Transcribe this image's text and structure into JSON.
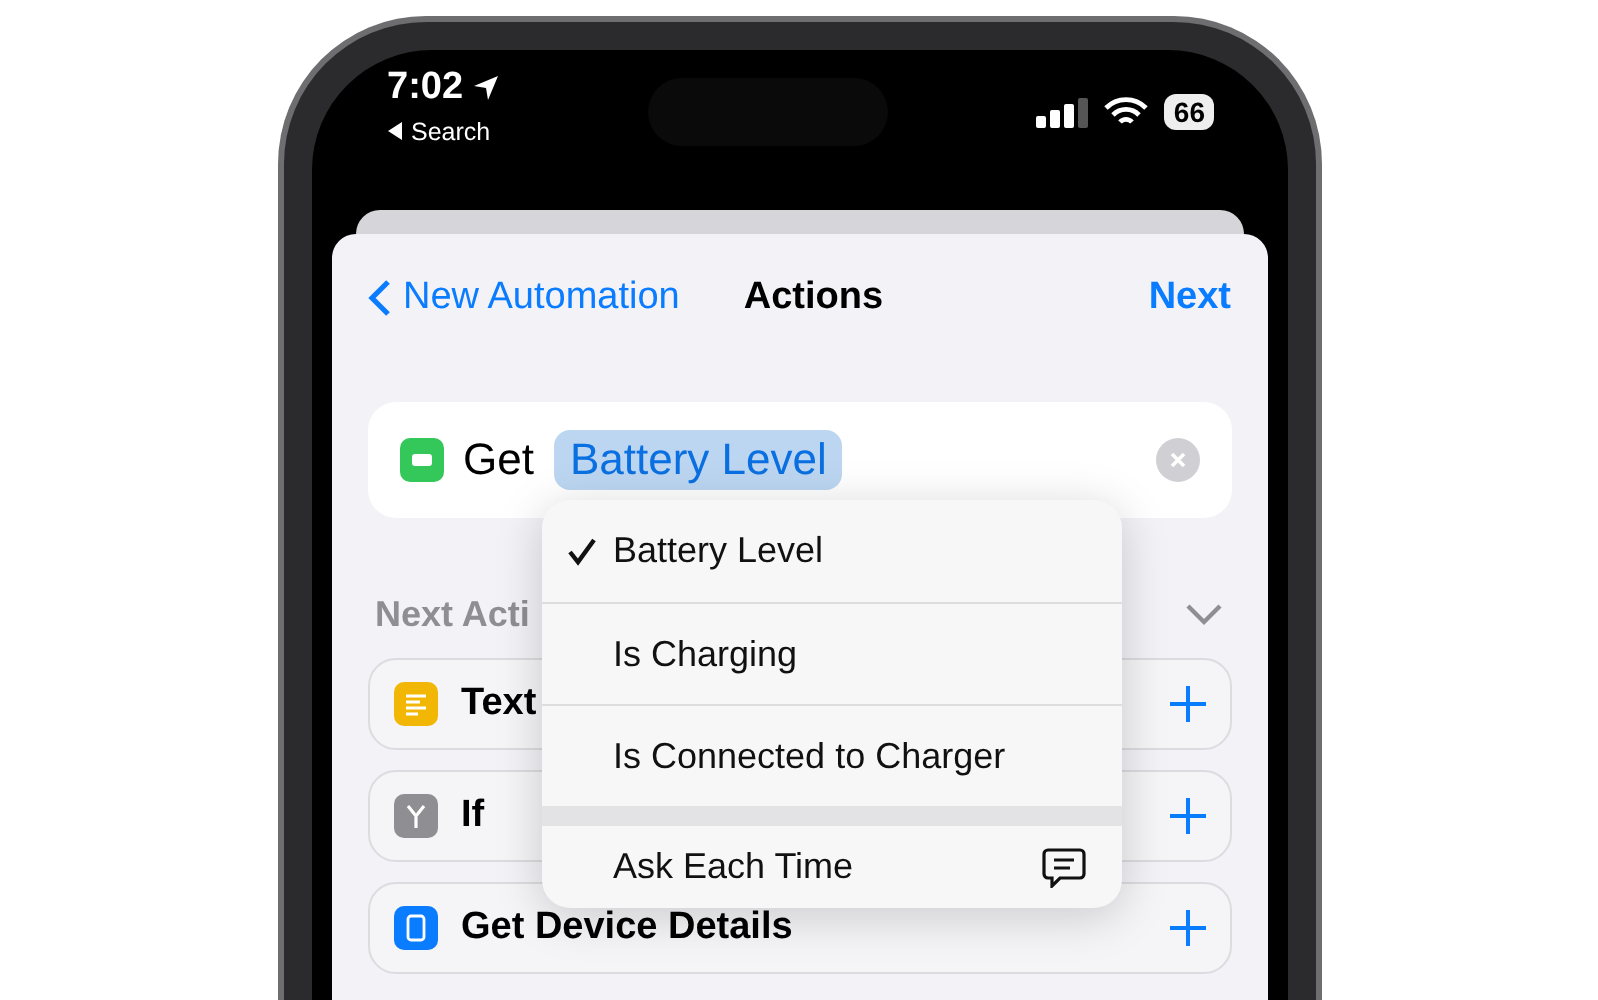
{
  "status_bar": {
    "time": "7:02",
    "back_label": "Search",
    "battery": "66"
  },
  "nav": {
    "back": "New Automation",
    "title": "Actions",
    "next": "Next"
  },
  "action": {
    "verb": "Get",
    "parameter": "Battery Level"
  },
  "menu": {
    "items": [
      {
        "label": "Battery Level",
        "selected": true,
        "kind": "option"
      },
      {
        "label": "Is Charging",
        "selected": false,
        "kind": "option"
      },
      {
        "label": "Is Connected to Charger",
        "selected": false,
        "kind": "option"
      },
      {
        "label": "Ask Each Time",
        "selected": false,
        "kind": "ask"
      }
    ]
  },
  "next_actions": {
    "heading": "Next Acti",
    "items": [
      {
        "label": "Text",
        "color": "#f2b705",
        "kind": "text"
      },
      {
        "label": "If",
        "color": "#8e8e93",
        "kind": "if"
      },
      {
        "label": "Get Device Details",
        "color": "#0a7cff",
        "kind": "device"
      }
    ]
  }
}
